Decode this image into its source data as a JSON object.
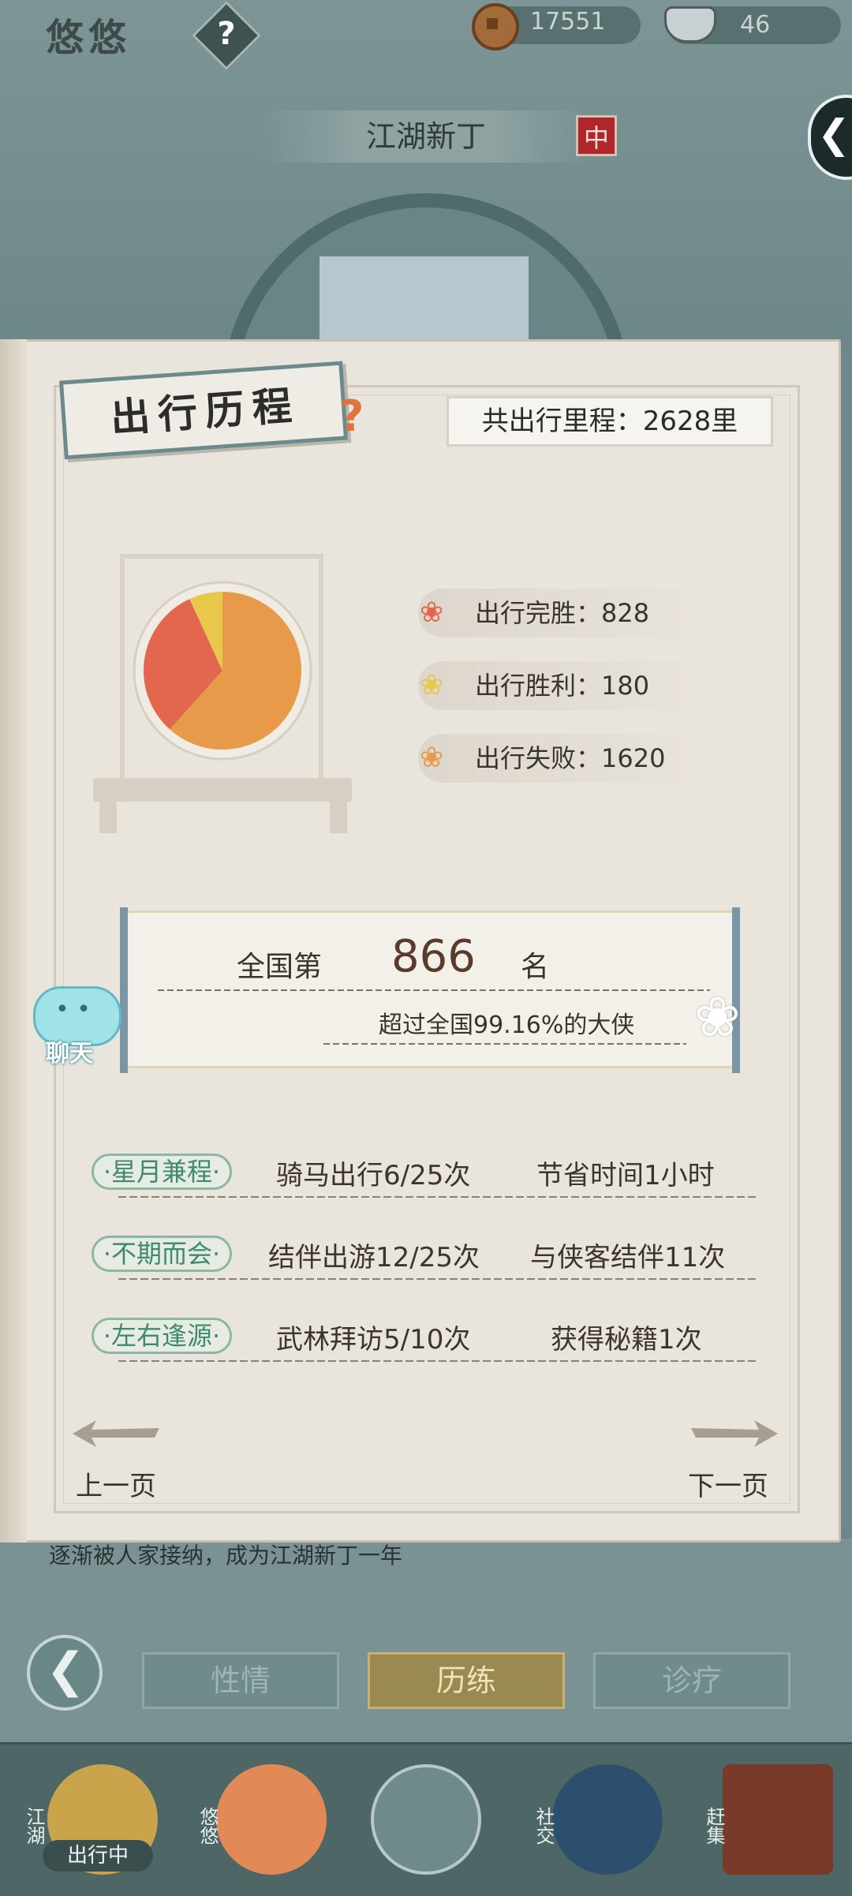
{
  "topbar": {
    "name": "悠悠",
    "help_label": "?",
    "coins": "17551",
    "ingots": "46"
  },
  "header": {
    "title": "江湖新丁",
    "seal": "中"
  },
  "book": {
    "tab_title": "出行历程",
    "tab_help": "?",
    "total_distance": "共出行里程：2628里",
    "stats": [
      {
        "label": "出行完胜：828",
        "color": "#e3664f",
        "icon": "flower-icon-red"
      },
      {
        "label": "出行胜利：180",
        "color": "#e8c74a",
        "icon": "flower-icon-yellow"
      },
      {
        "label": "出行失败：1620",
        "color": "#e69a4a",
        "icon": "flower-icon-orange"
      }
    ],
    "rank": {
      "prefix": "全国第",
      "number": "866",
      "suffix": "名",
      "subtitle": "超过全国99.16%的大侠"
    },
    "activities": [
      {
        "tag": "·星月兼程·",
        "progress": "骑马出行6/25次",
        "reward": "节省时间1小时"
      },
      {
        "tag": "·不期而会·",
        "progress": "结伴出游12/25次",
        "reward": "与侠客结伴11次"
      },
      {
        "tag": "·左右逢源·",
        "progress": "武林拜访5/10次",
        "reward": "获得秘籍1次"
      }
    ],
    "prev_page": "上一页",
    "next_page": "下一页"
  },
  "chat": {
    "label": "聊天"
  },
  "under_text": "逐渐被人家接纳，成为江湖新丁一年",
  "modes": [
    {
      "label": "性情",
      "active": false
    },
    {
      "label": "历练",
      "active": true
    },
    {
      "label": "诊疗",
      "active": false
    }
  ],
  "navbar": {
    "items": [
      {
        "label": "江湖",
        "status": "出行中"
      },
      {
        "label": "悠悠"
      },
      {
        "label": ""
      },
      {
        "label": "社交"
      },
      {
        "label": "赶集"
      }
    ]
  },
  "chart_data": {
    "type": "pie",
    "slices": [
      {
        "name": "出行完胜",
        "value": 828,
        "color": "#e3664f"
      },
      {
        "name": "出行胜利",
        "value": 180,
        "color": "#e8c74a"
      },
      {
        "name": "出行失败",
        "value": 1620,
        "color": "#e69a4a"
      }
    ]
  }
}
